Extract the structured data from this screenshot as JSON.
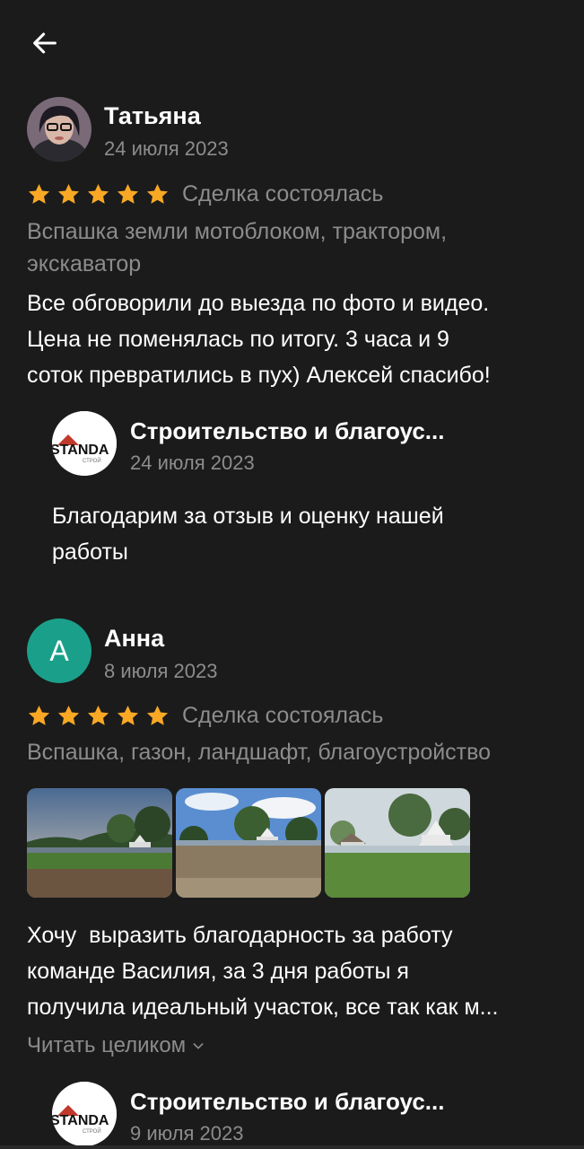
{
  "reviews": [
    {
      "author": "Татьяна",
      "date": "24 июля 2023",
      "rating": 5,
      "deal_status": "Сделка состоялась",
      "service": "Вспашка земли мотоблоком, трактором, экскаватор",
      "text_lines": [
        "Все обговорили до выезда по фото и видео.",
        "Цена не поменялась по итогу. 3 часа и 9",
        "соток превратились в пух) Алексей спасибо!"
      ],
      "reply": {
        "author": "Строительство и благоус...",
        "logo_text": "STANDA",
        "logo_subtext": "СТРОЙ",
        "date": "24 июля 2023",
        "text_lines": [
          "Благодарим за отзыв и оценку нашей",
          "работы"
        ]
      }
    },
    {
      "author": "Анна",
      "avatar_letter": "А",
      "date": "8 июля 2023",
      "rating": 5,
      "deal_status": "Сделка состоялась",
      "service": "Вспашка, газон, ландшафт, благоустройство",
      "photos": 3,
      "text_lines": [
        "Хочу  выразить благодарность за работу",
        "команде Василия, за 3 дня работы я",
        "получила идеальный участок, все так как м..."
      ],
      "read_more": "Читать целиком",
      "reply": {
        "author": "Строительство и благоус...",
        "logo_text": "STANDA",
        "logo_subtext": "СТРОЙ",
        "date": "9 июля 2023"
      }
    }
  ],
  "colors": {
    "background": "#1b1b1b",
    "star": "#f9a825",
    "muted": "#8c8c8c",
    "avatar_teal": "#1aa08a"
  },
  "icons": {
    "back": "arrow-left-icon",
    "star": "star-icon",
    "chevron": "chevron-down-icon"
  }
}
